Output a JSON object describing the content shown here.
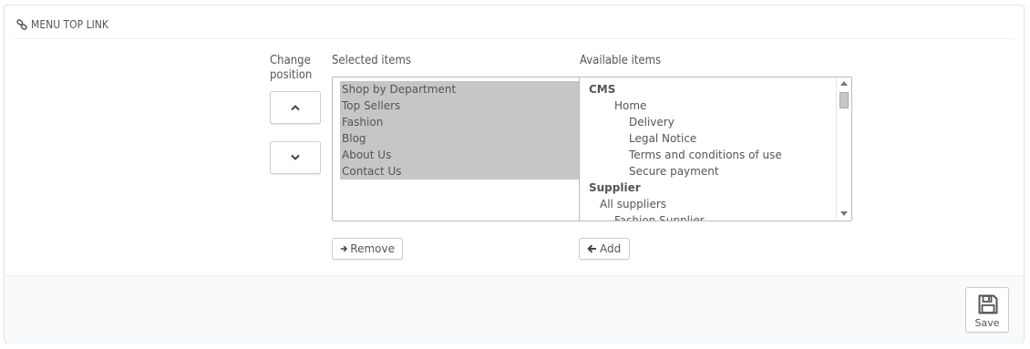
{
  "panel": {
    "title": "MENU TOP LINK",
    "icon": "link-icon"
  },
  "change_position": {
    "label_line1": "Change",
    "label_line2": "position",
    "up_icon": "chevron-up-icon",
    "down_icon": "chevron-down-icon"
  },
  "selected": {
    "label": "Selected items",
    "items": [
      "Shop by Department",
      "Top Sellers",
      "Fashion",
      "Blog",
      "About Us",
      "Contact Us"
    ],
    "remove_label": "Remove"
  },
  "available": {
    "label": "Available items",
    "items": [
      {
        "text": "CMS",
        "bold": true
      },
      {
        "text": "Home",
        "bold": false
      },
      {
        "text": "Delivery",
        "bold": false
      },
      {
        "text": "Legal Notice",
        "bold": false
      },
      {
        "text": "Terms and conditions of use",
        "bold": false
      },
      {
        "text": "Secure payment",
        "bold": false
      },
      {
        "text": "Supplier",
        "bold": true
      },
      {
        "text": "All suppliers",
        "bold": false
      },
      {
        "text": "Fashion Supplier",
        "bold": false
      }
    ],
    "add_label": "Add"
  },
  "footer": {
    "save_label": "Save",
    "save_icon": "floppy-disk-icon"
  }
}
